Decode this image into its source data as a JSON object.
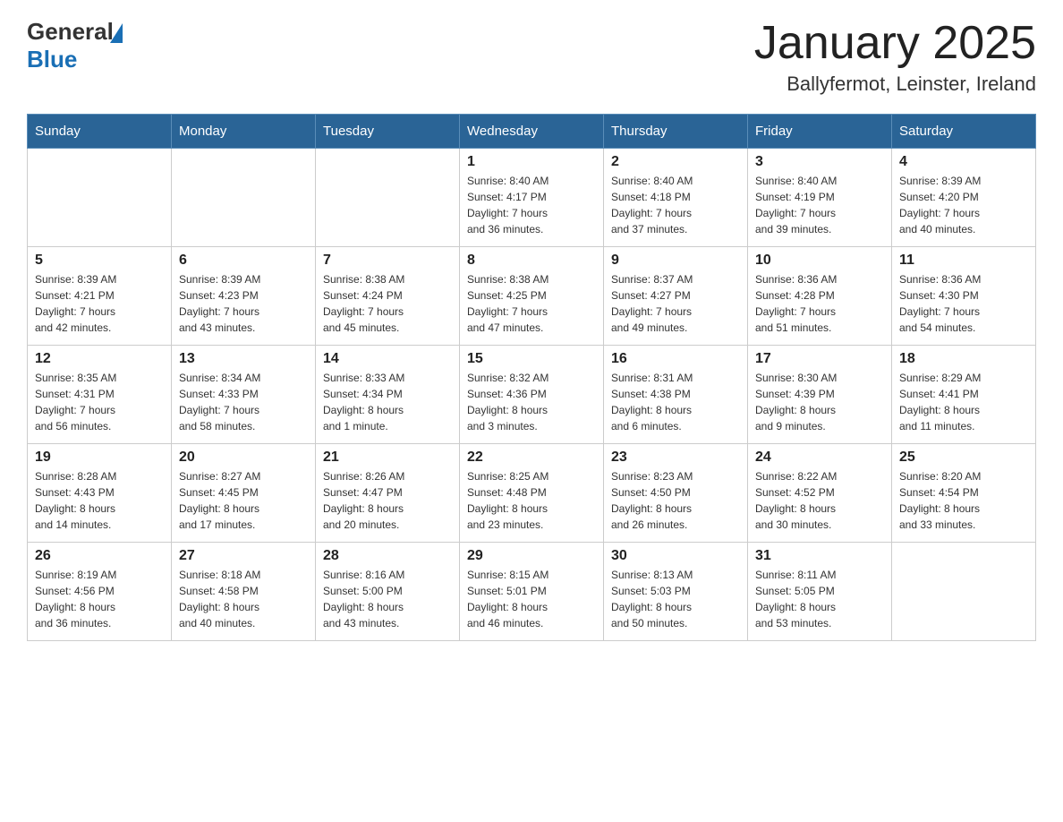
{
  "header": {
    "logo": {
      "general": "General",
      "blue": "Blue"
    },
    "title": "January 2025",
    "subtitle": "Ballyfermot, Leinster, Ireland"
  },
  "calendar": {
    "days_of_week": [
      "Sunday",
      "Monday",
      "Tuesday",
      "Wednesday",
      "Thursday",
      "Friday",
      "Saturday"
    ],
    "weeks": [
      [
        {
          "day": "",
          "info": ""
        },
        {
          "day": "",
          "info": ""
        },
        {
          "day": "",
          "info": ""
        },
        {
          "day": "1",
          "info": "Sunrise: 8:40 AM\nSunset: 4:17 PM\nDaylight: 7 hours\nand 36 minutes."
        },
        {
          "day": "2",
          "info": "Sunrise: 8:40 AM\nSunset: 4:18 PM\nDaylight: 7 hours\nand 37 minutes."
        },
        {
          "day": "3",
          "info": "Sunrise: 8:40 AM\nSunset: 4:19 PM\nDaylight: 7 hours\nand 39 minutes."
        },
        {
          "day": "4",
          "info": "Sunrise: 8:39 AM\nSunset: 4:20 PM\nDaylight: 7 hours\nand 40 minutes."
        }
      ],
      [
        {
          "day": "5",
          "info": "Sunrise: 8:39 AM\nSunset: 4:21 PM\nDaylight: 7 hours\nand 42 minutes."
        },
        {
          "day": "6",
          "info": "Sunrise: 8:39 AM\nSunset: 4:23 PM\nDaylight: 7 hours\nand 43 minutes."
        },
        {
          "day": "7",
          "info": "Sunrise: 8:38 AM\nSunset: 4:24 PM\nDaylight: 7 hours\nand 45 minutes."
        },
        {
          "day": "8",
          "info": "Sunrise: 8:38 AM\nSunset: 4:25 PM\nDaylight: 7 hours\nand 47 minutes."
        },
        {
          "day": "9",
          "info": "Sunrise: 8:37 AM\nSunset: 4:27 PM\nDaylight: 7 hours\nand 49 minutes."
        },
        {
          "day": "10",
          "info": "Sunrise: 8:36 AM\nSunset: 4:28 PM\nDaylight: 7 hours\nand 51 minutes."
        },
        {
          "day": "11",
          "info": "Sunrise: 8:36 AM\nSunset: 4:30 PM\nDaylight: 7 hours\nand 54 minutes."
        }
      ],
      [
        {
          "day": "12",
          "info": "Sunrise: 8:35 AM\nSunset: 4:31 PM\nDaylight: 7 hours\nand 56 minutes."
        },
        {
          "day": "13",
          "info": "Sunrise: 8:34 AM\nSunset: 4:33 PM\nDaylight: 7 hours\nand 58 minutes."
        },
        {
          "day": "14",
          "info": "Sunrise: 8:33 AM\nSunset: 4:34 PM\nDaylight: 8 hours\nand 1 minute."
        },
        {
          "day": "15",
          "info": "Sunrise: 8:32 AM\nSunset: 4:36 PM\nDaylight: 8 hours\nand 3 minutes."
        },
        {
          "day": "16",
          "info": "Sunrise: 8:31 AM\nSunset: 4:38 PM\nDaylight: 8 hours\nand 6 minutes."
        },
        {
          "day": "17",
          "info": "Sunrise: 8:30 AM\nSunset: 4:39 PM\nDaylight: 8 hours\nand 9 minutes."
        },
        {
          "day": "18",
          "info": "Sunrise: 8:29 AM\nSunset: 4:41 PM\nDaylight: 8 hours\nand 11 minutes."
        }
      ],
      [
        {
          "day": "19",
          "info": "Sunrise: 8:28 AM\nSunset: 4:43 PM\nDaylight: 8 hours\nand 14 minutes."
        },
        {
          "day": "20",
          "info": "Sunrise: 8:27 AM\nSunset: 4:45 PM\nDaylight: 8 hours\nand 17 minutes."
        },
        {
          "day": "21",
          "info": "Sunrise: 8:26 AM\nSunset: 4:47 PM\nDaylight: 8 hours\nand 20 minutes."
        },
        {
          "day": "22",
          "info": "Sunrise: 8:25 AM\nSunset: 4:48 PM\nDaylight: 8 hours\nand 23 minutes."
        },
        {
          "day": "23",
          "info": "Sunrise: 8:23 AM\nSunset: 4:50 PM\nDaylight: 8 hours\nand 26 minutes."
        },
        {
          "day": "24",
          "info": "Sunrise: 8:22 AM\nSunset: 4:52 PM\nDaylight: 8 hours\nand 30 minutes."
        },
        {
          "day": "25",
          "info": "Sunrise: 8:20 AM\nSunset: 4:54 PM\nDaylight: 8 hours\nand 33 minutes."
        }
      ],
      [
        {
          "day": "26",
          "info": "Sunrise: 8:19 AM\nSunset: 4:56 PM\nDaylight: 8 hours\nand 36 minutes."
        },
        {
          "day": "27",
          "info": "Sunrise: 8:18 AM\nSunset: 4:58 PM\nDaylight: 8 hours\nand 40 minutes."
        },
        {
          "day": "28",
          "info": "Sunrise: 8:16 AM\nSunset: 5:00 PM\nDaylight: 8 hours\nand 43 minutes."
        },
        {
          "day": "29",
          "info": "Sunrise: 8:15 AM\nSunset: 5:01 PM\nDaylight: 8 hours\nand 46 minutes."
        },
        {
          "day": "30",
          "info": "Sunrise: 8:13 AM\nSunset: 5:03 PM\nDaylight: 8 hours\nand 50 minutes."
        },
        {
          "day": "31",
          "info": "Sunrise: 8:11 AM\nSunset: 5:05 PM\nDaylight: 8 hours\nand 53 minutes."
        },
        {
          "day": "",
          "info": ""
        }
      ]
    ]
  }
}
